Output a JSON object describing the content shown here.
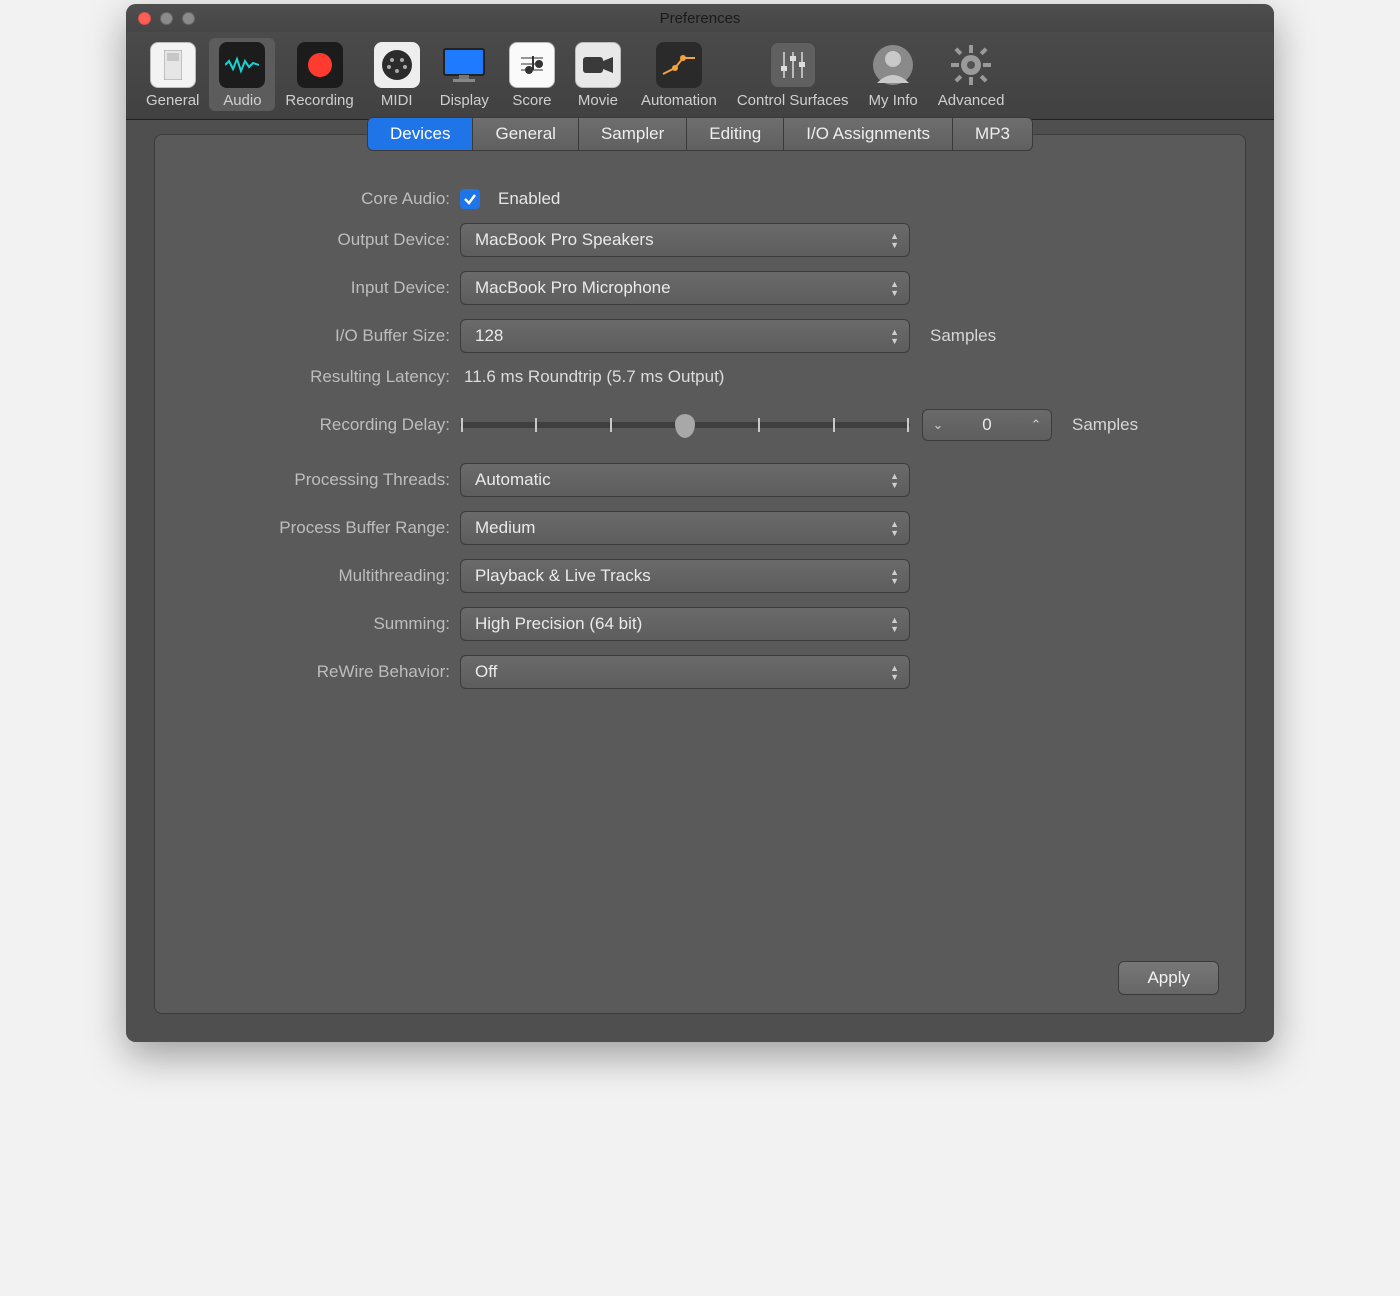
{
  "window": {
    "title": "Preferences"
  },
  "toolbar": {
    "items": [
      {
        "label": "General"
      },
      {
        "label": "Audio"
      },
      {
        "label": "Recording"
      },
      {
        "label": "MIDI"
      },
      {
        "label": "Display"
      },
      {
        "label": "Score"
      },
      {
        "label": "Movie"
      },
      {
        "label": "Automation"
      },
      {
        "label": "Control Surfaces"
      },
      {
        "label": "My Info"
      },
      {
        "label": "Advanced"
      }
    ],
    "active_index": 1
  },
  "subtabs": {
    "items": [
      "Devices",
      "General",
      "Sampler",
      "Editing",
      "I/O Assignments",
      "MP3"
    ],
    "active_index": 0
  },
  "form": {
    "core_audio": {
      "label": "Core Audio:",
      "enabled_text": "Enabled",
      "checked": true
    },
    "output_device": {
      "label": "Output Device:",
      "value": "MacBook Pro Speakers"
    },
    "input_device": {
      "label": "Input Device:",
      "value": "MacBook Pro Microphone"
    },
    "io_buffer": {
      "label": "I/O Buffer Size:",
      "value": "128",
      "unit": "Samples"
    },
    "latency": {
      "label": "Resulting Latency:",
      "value": "11.6 ms Roundtrip (5.7 ms Output)"
    },
    "recording_delay": {
      "label": "Recording Delay:",
      "value": "0",
      "unit": "Samples"
    },
    "processing_threads": {
      "label": "Processing Threads:",
      "value": "Automatic"
    },
    "process_buffer_range": {
      "label": "Process Buffer Range:",
      "value": "Medium"
    },
    "multithreading": {
      "label": "Multithreading:",
      "value": "Playback & Live Tracks"
    },
    "summing": {
      "label": "Summing:",
      "value": "High Precision (64 bit)"
    },
    "rewire": {
      "label": "ReWire Behavior:",
      "value": "Off"
    }
  },
  "buttons": {
    "apply": "Apply"
  }
}
